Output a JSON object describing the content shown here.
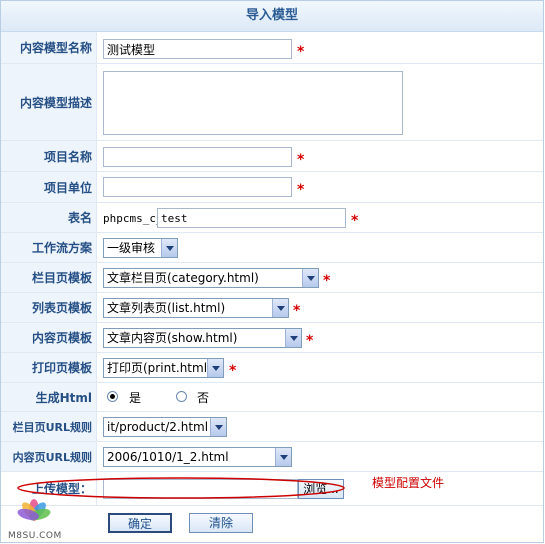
{
  "title": "导入模型",
  "required_mark": "*",
  "fields": {
    "model_name": {
      "label": "内容模型名称",
      "value": "测试模型"
    },
    "model_desc": {
      "label": "内容模型描述",
      "value": ""
    },
    "item_name": {
      "label": "项目名称",
      "value": ""
    },
    "item_unit": {
      "label": "项目单位",
      "value": ""
    },
    "table_name": {
      "label": "表名",
      "prefix": "phpcms_c_",
      "value": "test"
    },
    "workflow": {
      "label": "工作流方案",
      "value": "一级审核"
    },
    "category_tpl": {
      "label": "栏目页模板",
      "value": "文章栏目页(category.html)"
    },
    "list_tpl": {
      "label": "列表页模板",
      "value": "文章列表页(list.html)"
    },
    "show_tpl": {
      "label": "内容页模板",
      "value": "文章内容页(show.html)"
    },
    "print_tpl": {
      "label": "打印页模板",
      "value": "打印页(print.html)"
    },
    "gen_html": {
      "label": "生成Html",
      "yes": "是",
      "no": "否",
      "selected": "yes"
    },
    "cat_url": {
      "label": "栏目页URL规则",
      "value": "it/product/2.html"
    },
    "show_url": {
      "label": "内容页URL规则",
      "value": "2006/1010/1_2.html"
    },
    "upload": {
      "label": "上传模型：",
      "value": "",
      "browse": "浏览...",
      "annotation": "模型配置文件"
    }
  },
  "buttons": {
    "confirm": "确定",
    "clear": "清除"
  },
  "watermark": {
    "text": "M8SU.COM"
  }
}
